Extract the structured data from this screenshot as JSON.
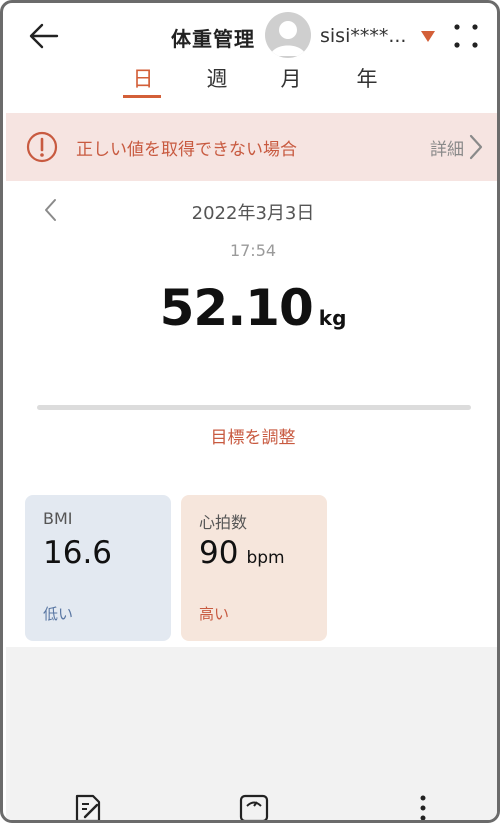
{
  "header": {
    "title": "体重管理",
    "user_name": "sisi****...",
    "back_icon": "arrow-left-icon",
    "more_icon": "grid-dots-icon"
  },
  "tabs": [
    {
      "label": "日",
      "active": true
    },
    {
      "label": "週",
      "active": false
    },
    {
      "label": "月",
      "active": false
    },
    {
      "label": "年",
      "active": false
    }
  ],
  "banner": {
    "text": "正しい値を取得できない場合",
    "link_label": "詳細",
    "icon": "info-circle-icon"
  },
  "reading": {
    "date": "2022年3月3日",
    "time": "17:54",
    "weight": "52.10",
    "unit": "kg",
    "goal_link": "目標を調整"
  },
  "cards": {
    "bmi": {
      "label": "BMI",
      "value": "16.6",
      "status": "低い"
    },
    "heart_rate": {
      "label": "心拍数",
      "value": "90",
      "unit": "bpm",
      "status": "高い"
    }
  },
  "toolbar": {
    "icons": [
      "edit-note-icon",
      "scale-icon",
      "more-vertical-icon"
    ]
  },
  "colors": {
    "accent": "#d35f38",
    "banner_bg": "#f6e4e1",
    "bmi_card_bg": "#e3e9f1",
    "heart_card_bg": "#f6e6dc"
  }
}
